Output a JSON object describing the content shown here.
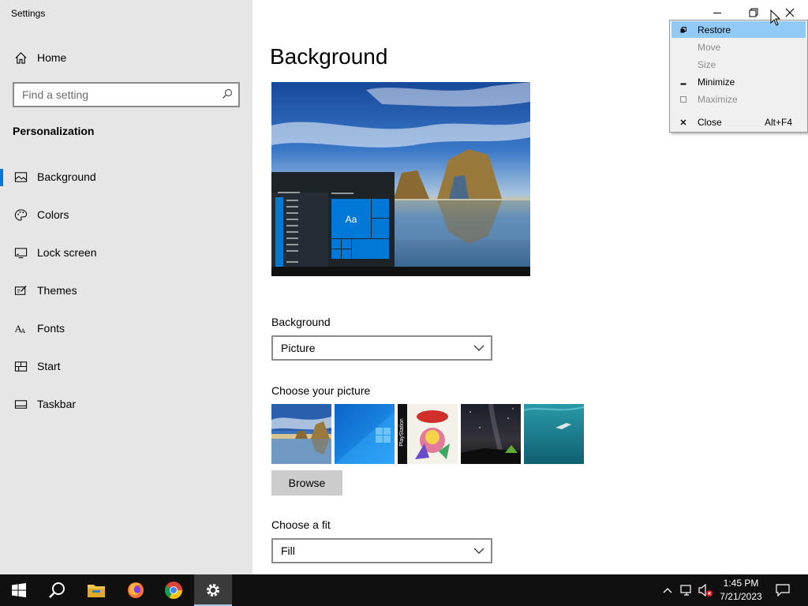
{
  "window": {
    "title": "Settings"
  },
  "sidebar": {
    "home_label": "Home",
    "search_placeholder": "Find a setting",
    "section_title": "Personalization",
    "items": [
      {
        "label": "Background",
        "icon": "picture-icon",
        "selected": true
      },
      {
        "label": "Colors",
        "icon": "palette-icon",
        "selected": false
      },
      {
        "label": "Lock screen",
        "icon": "monitor-icon",
        "selected": false
      },
      {
        "label": "Themes",
        "icon": "themes-icon",
        "selected": false
      },
      {
        "label": "Fonts",
        "icon": "font-icon",
        "selected": false
      },
      {
        "label": "Start",
        "icon": "start-icon",
        "selected": false
      },
      {
        "label": "Taskbar",
        "icon": "taskbar-icon",
        "selected": false
      }
    ]
  },
  "main": {
    "page_title": "Background",
    "preview": {
      "tile_text": "Aa"
    },
    "background_label": "Background",
    "background_value": "Picture",
    "choose_picture_label": "Choose your picture",
    "thumbnails": [
      "Windows 10 beach rock",
      "Windows 10 blue logo",
      "PlayStation game cover",
      "Night sky with tent",
      "Underwater swimmer"
    ],
    "thumbnail_cover_text": "PlayStation",
    "browse_label": "Browse",
    "fit_label": "Choose a fit",
    "fit_value": "Fill"
  },
  "context_menu": {
    "items": [
      {
        "label": "Restore",
        "icon": "restore-icon",
        "enabled": true,
        "highlighted": true,
        "shortcut": ""
      },
      {
        "label": "Move",
        "icon": "",
        "enabled": false,
        "highlighted": false,
        "shortcut": ""
      },
      {
        "label": "Size",
        "icon": "",
        "enabled": false,
        "highlighted": false,
        "shortcut": ""
      },
      {
        "label": "Minimize",
        "icon": "minimize-icon",
        "enabled": true,
        "highlighted": false,
        "shortcut": ""
      },
      {
        "label": "Maximize",
        "icon": "maximize-icon",
        "enabled": false,
        "highlighted": false,
        "shortcut": ""
      },
      {
        "label": "Close",
        "icon": "close-icon",
        "enabled": true,
        "highlighted": false,
        "shortcut": "Alt+F4"
      }
    ]
  },
  "taskbar": {
    "apps": [
      "start-icon",
      "search-icon",
      "file-explorer-icon",
      "firefox-icon",
      "chrome-icon",
      "settings-icon"
    ],
    "time": "1:45 PM",
    "date": "7/21/2023"
  },
  "colors": {
    "accent": "#0078d7",
    "sidebar_bg": "#e6e6e6",
    "menu_highlight": "#91c9f7",
    "taskbar_bg": "#101010"
  }
}
